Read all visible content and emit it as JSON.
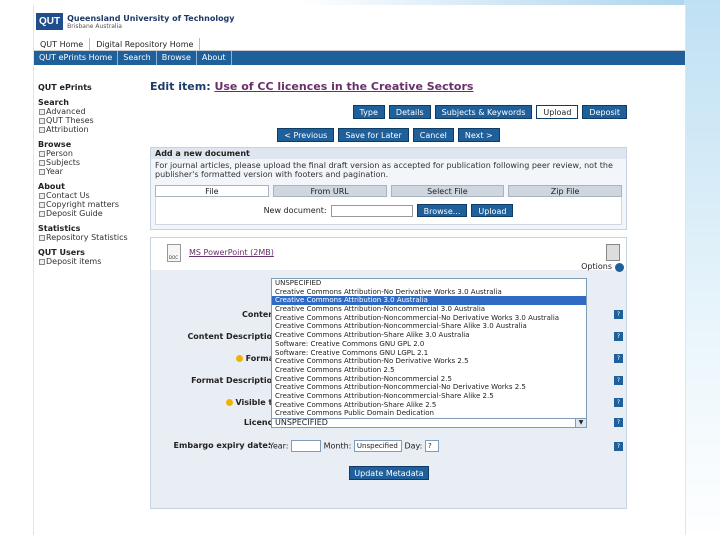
{
  "brand": {
    "logo": "QUT",
    "name": "Queensland University of Technology",
    "sub": "Brisbane Australia"
  },
  "top_nav": [
    "QUT Home",
    "Digital Repository Home"
  ],
  "app_nav": [
    "QUT ePrints Home",
    "Search",
    "Browse",
    "About"
  ],
  "sidebar": {
    "title": "QUT ePrints",
    "groups": [
      {
        "heading": "Search",
        "items": [
          "Advanced",
          "QUT Theses",
          "Attribution"
        ]
      },
      {
        "heading": "Browse",
        "items": [
          "Person",
          "Subjects",
          "Year"
        ]
      },
      {
        "heading": "About",
        "items": [
          "Contact Us",
          "Copyright matters",
          "Deposit Guide"
        ]
      },
      {
        "heading": "Statistics",
        "items": [
          "Repository Statistics"
        ]
      },
      {
        "heading": "QUT Users",
        "items": [
          "Deposit items"
        ]
      }
    ]
  },
  "main": {
    "title_prefix": "Edit item:",
    "title_link": "Use of CC licences in the Creative Sectors",
    "wizard": [
      "Type",
      "Details",
      "Subjects & Keywords",
      "Upload",
      "Deposit"
    ],
    "wizard_current": "Upload",
    "nav_buttons": [
      "< Previous",
      "Save for Later",
      "Cancel",
      "Next >"
    ],
    "add_doc": {
      "heading": "Add a new document",
      "description": "For journal articles, please upload the final draft version as accepted for publication following peer review, not the publisher's formatted version with footers and pagination.",
      "tabs": [
        "File",
        "From URL",
        "Select File",
        "Zip File"
      ],
      "new_doc_label": "New document:",
      "browse": "Browse...",
      "upload": "Upload"
    },
    "document": {
      "file_name": "MS PowerPoint (2MB)",
      "icon_caption": "DOC",
      "more_options": "Options"
    },
    "form": {
      "content_label": "Content:",
      "content_desc_label": "Content Description:",
      "format_label": "Format:",
      "format_desc_label": "Format Description:",
      "visible_label": "Visible to:",
      "licence_label": "Licence:",
      "licence_value": "UNSPECIFIED",
      "embargo_label": "Embargo expiry date:",
      "year_label": "Year:",
      "month_label": "Month:",
      "month_value": "Unspecified",
      "day_label": "Day:",
      "day_value": "?",
      "update_button": "Update Metadata"
    },
    "licence_options": [
      "UNSPECIFIED",
      "Creative Commons Attribution-No Derivative Works 3.0 Australia",
      "Creative Commons Attribution 3.0 Australia",
      "Creative Commons Attribution-Noncommercial 3.0 Australia",
      "Creative Commons Attribution-Noncommercial-No Derivative Works 3.0 Australia",
      "Creative Commons Attribution-Noncommercial-Share Alike 3.0 Australia",
      "Creative Commons Attribution-Share Alike 3.0 Australia",
      "Software: Creative Commons GNU GPL 2.0",
      "Software: Creative Commons GNU LGPL 2.1",
      "Creative Commons Attribution-No Derivative Works 2.5",
      "Creative Commons Attribution 2.5",
      "Creative Commons Attribution-Noncommercial 2.5",
      "Creative Commons Attribution-Noncommercial-No Derivative Works 2.5",
      "Creative Commons Attribution-Noncommercial-Share Alike 2.5",
      "Creative Commons Attribution-Share Alike 2.5",
      "Creative Commons Public Domain Dedication"
    ],
    "licence_selected_index": 2
  }
}
